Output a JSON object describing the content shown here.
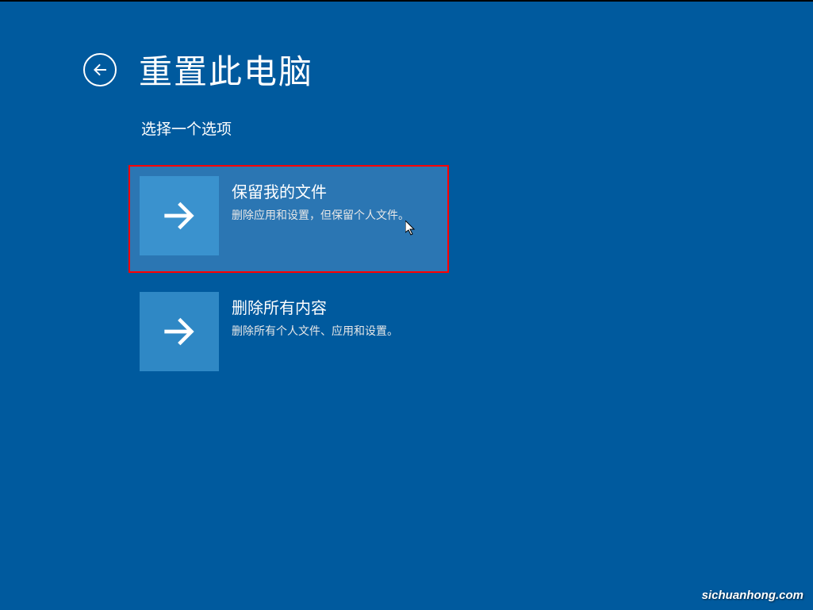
{
  "header": {
    "title": "重置此电脑"
  },
  "subtitle": "选择一个选项",
  "options": [
    {
      "title": "保留我的文件",
      "desc": "删除应用和设置，但保留个人文件。"
    },
    {
      "title": "删除所有内容",
      "desc": "删除所有个人文件、应用和设置。"
    }
  ],
  "watermark": "sichuanhong.com"
}
